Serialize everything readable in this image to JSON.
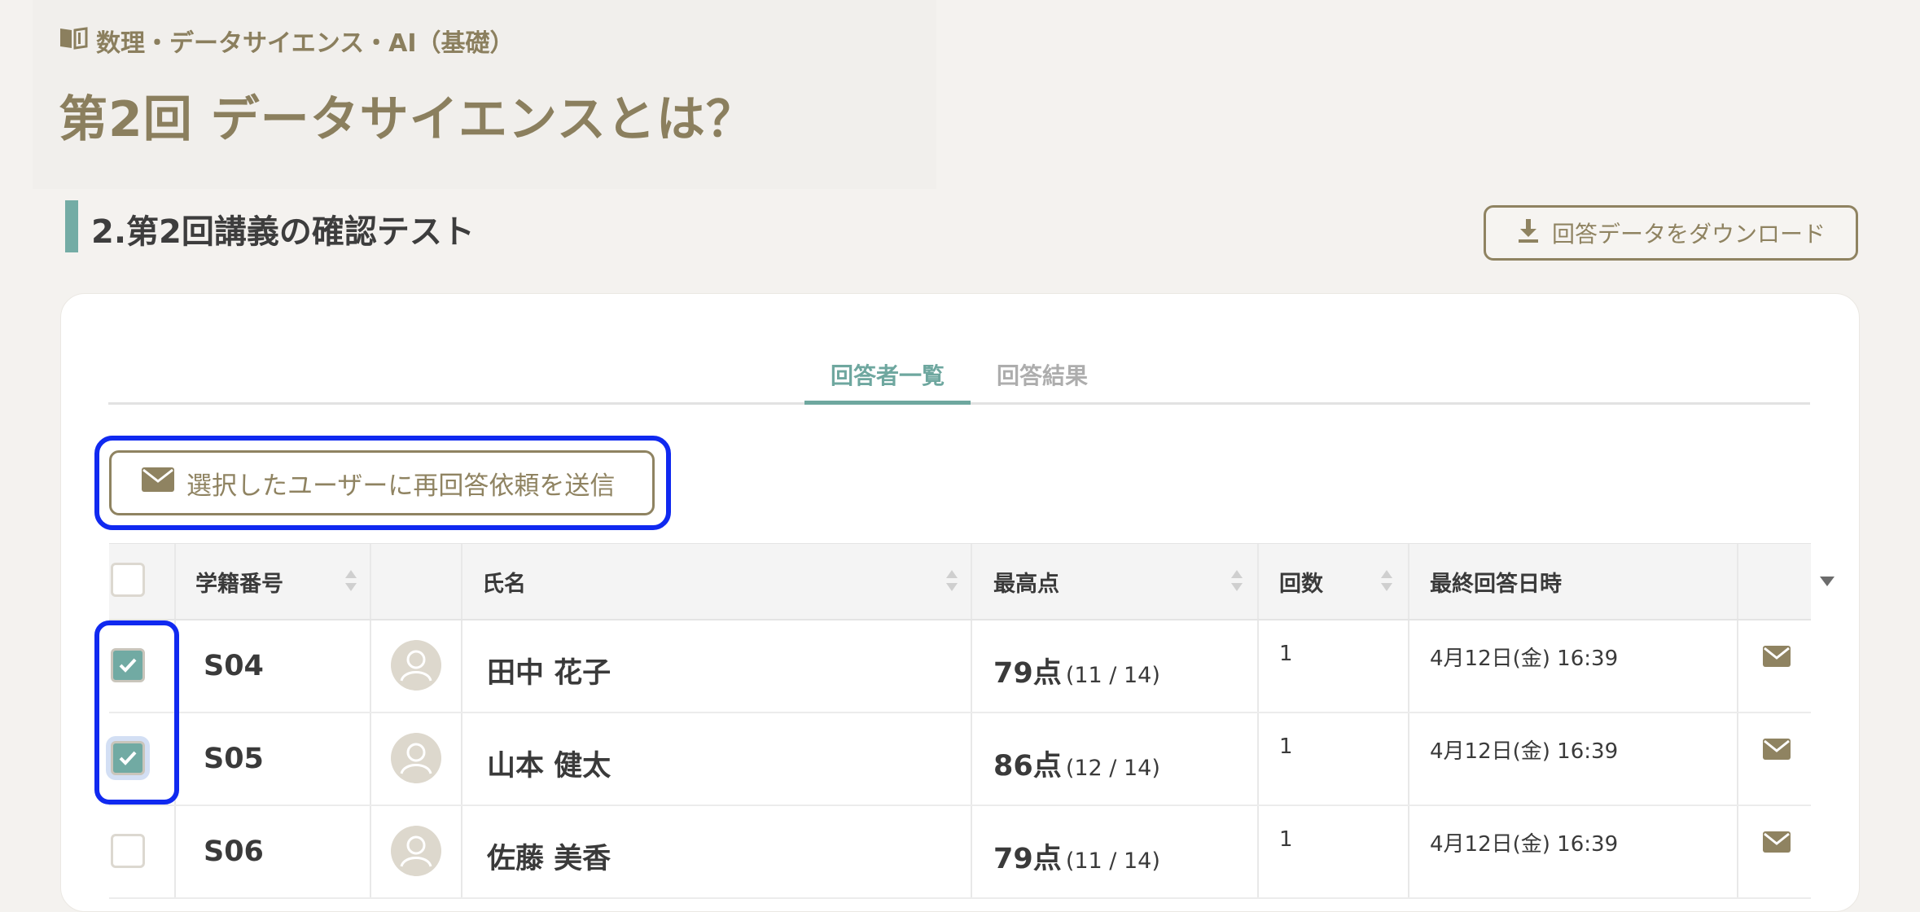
{
  "header": {
    "course": "数理・データサイエンス・AI（基礎）",
    "title": "第2回 データサイエンスとは？"
  },
  "section": {
    "title": "2.第2回講義の確認テスト",
    "download_label": "回答データをダウンロード"
  },
  "tabs": [
    {
      "label": "回答者一覧",
      "active": true
    },
    {
      "label": "回答結果",
      "active": false
    }
  ],
  "resend_label": "選択したユーザーに再回答依頼を送信",
  "table": {
    "columns": [
      "学籍番号",
      "氏名",
      "最高点",
      "回数",
      "最終回答日時"
    ],
    "rows": [
      {
        "id": "S04",
        "name": "田中 花子",
        "score": "79点",
        "score_detail": "(11 / 14)",
        "count": "1",
        "date": "4月12日(金) 16:39",
        "checked": true
      },
      {
        "id": "S05",
        "name": "山本 健太",
        "score": "86点",
        "score_detail": "(12 / 14)",
        "count": "1",
        "date": "4月12日(金) 16:39",
        "checked": true
      },
      {
        "id": "S06",
        "name": "佐藤 美香",
        "score": "79点",
        "score_detail": "(11 / 14)",
        "count": "1",
        "date": "4月12日(金) 16:39",
        "checked": false
      }
    ]
  },
  "colors": {
    "accent": "#6ea79f",
    "brand": "#8b7f5e",
    "highlight": "#1029f0"
  },
  "icons": [
    "book-icon",
    "download-icon",
    "mail-icon",
    "avatar-icon",
    "sort-icon",
    "check-icon"
  ]
}
